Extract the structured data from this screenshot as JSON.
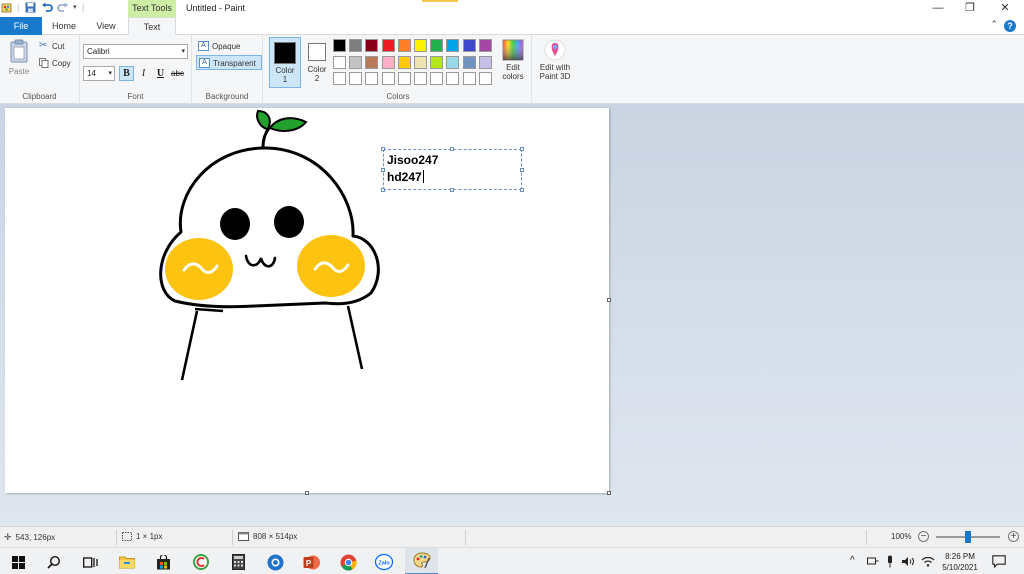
{
  "titlebar": {
    "contextual_tab": "Text Tools",
    "document_title": "Untitled - Paint",
    "minimize": "—",
    "restore": "❐",
    "close": "✕"
  },
  "tabs": {
    "file": "File",
    "home": "Home",
    "view": "View",
    "text": "Text",
    "help": "?",
    "collapse": "⌃"
  },
  "ribbon": {
    "clipboard": {
      "label": "Clipboard",
      "paste": "Paste",
      "cut": "Cut",
      "copy": "Copy"
    },
    "font": {
      "label": "Font",
      "family": "Calibri",
      "size": "14",
      "bold": "B",
      "italic": "I",
      "underline": "U",
      "strike": "abc"
    },
    "background": {
      "label": "Background",
      "opaque": "Opaque",
      "transparent": "Transparent"
    },
    "colors": {
      "label": "Colors",
      "color1_line1": "Color",
      "color1_line2": "1",
      "color2_line1": "Color",
      "color2_line2": "2",
      "color1_value": "#000000",
      "color2_value": "#ffffff",
      "edit_line1": "Edit",
      "edit_line2": "colors",
      "paint3d_line1": "Edit with",
      "paint3d_line2": "Paint 3D",
      "palette_row1": [
        "#000000",
        "#7f7f7f",
        "#880015",
        "#ed1c24",
        "#ff7f27",
        "#fff200",
        "#22b14c",
        "#00a2e8",
        "#3f48cc",
        "#a349a4"
      ],
      "palette_row2": [
        "#ffffff",
        "#c3c3c3",
        "#b97a57",
        "#ffaec9",
        "#ffc90e",
        "#efe4b0",
        "#b5e61d",
        "#99d9ea",
        "#7092be",
        "#c8bfe7"
      ],
      "palette_row3": [
        "#ffffff",
        "#ffffff",
        "#ffffff",
        "#ffffff",
        "#ffffff",
        "#ffffff",
        "#ffffff",
        "#ffffff",
        "#ffffff",
        "#ffffff"
      ]
    }
  },
  "canvas": {
    "textbox_line1": "Jisoo247",
    "textbox_line2": "hd247"
  },
  "statusbar": {
    "cursor_pos": "543, 126px",
    "selection_size": "1 × 1px",
    "image_size": "808 × 514px",
    "zoom": "100%",
    "zoom_out": "−",
    "zoom_in": "+",
    "zoom_level": 0.5
  },
  "taskbar": {
    "time": "8:26 PM",
    "date": "5/10/2021"
  }
}
